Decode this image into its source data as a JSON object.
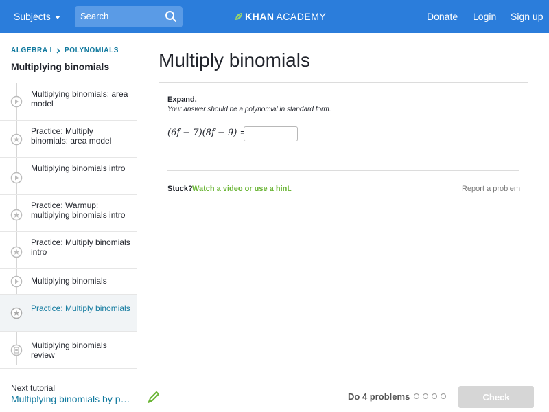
{
  "header": {
    "subjects_label": "Subjects",
    "search_placeholder": "Search",
    "logo_bold": "KHAN",
    "logo_light": "ACADEMY",
    "donate_label": "Donate",
    "login_label": "Login",
    "signup_label": "Sign up",
    "bar_color": "#2b7ddb"
  },
  "sidebar": {
    "breadcrumb": [
      "ALGEBRA I",
      "POLYNOMIALS"
    ],
    "tutorial_title": "Multiplying binomials",
    "items": [
      {
        "label": "Multiplying binomials: area model",
        "icon": "play-icon",
        "active": false
      },
      {
        "label": "Practice: Multiply binomials: area model",
        "icon": "star-icon",
        "active": false
      },
      {
        "label": "Multiplying binomials intro",
        "icon": "play-icon",
        "active": false
      },
      {
        "label": "Practice: Warmup: multiplying binomials intro",
        "icon": "star-icon",
        "active": false
      },
      {
        "label": "Practice: Multiply binomials intro",
        "icon": "star-icon",
        "active": false
      },
      {
        "label": "Multiplying binomials",
        "icon": "play-icon",
        "active": false
      },
      {
        "label": "Practice: Multiply binomials",
        "icon": "star-icon",
        "active": true
      },
      {
        "label": "Multiplying binomials review",
        "icon": "article-icon",
        "active": false
      }
    ],
    "next_label": "Next tutorial",
    "next_link": "Multiplying binomials by polynomials"
  },
  "main": {
    "title": "Multiply binomials",
    "expand_label": "Expand.",
    "instruction": "Your answer should be a polynomial in standard form.",
    "equation": "(6f − 7)(8f − 9) =",
    "answer_value": "",
    "stuck_label": "Stuck?",
    "hint_link": "Watch a video or use a hint.",
    "report_link": "Report a problem"
  },
  "footer": {
    "do_label": "Do 4 problems",
    "problem_count": 4,
    "check_label": "Check"
  }
}
